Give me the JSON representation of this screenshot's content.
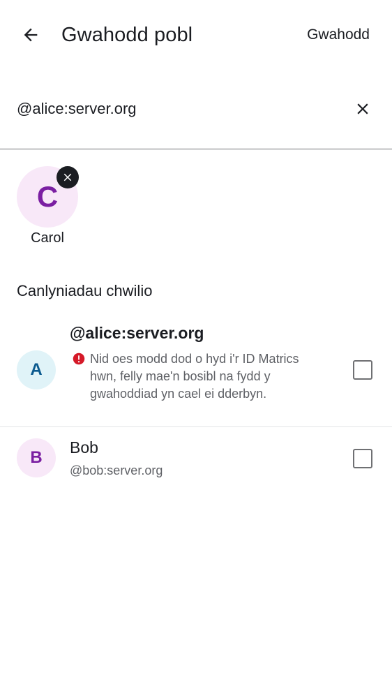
{
  "header": {
    "title": "Gwahodd pobl",
    "action_label": "Gwahodd",
    "back_icon": "arrow-left-icon"
  },
  "search": {
    "value": "@alice:server.org",
    "clear_icon": "close-icon"
  },
  "selected_users": [
    {
      "initial": "C",
      "name": "Carol",
      "remove_icon": "close-icon"
    }
  ],
  "results": {
    "section_title": "Canlyniadau chwilio",
    "items": [
      {
        "initial": "A",
        "name": "@alice:server.org",
        "warning": "Nid oes modd dod o hyd i'r ID Matrics hwn, felly mae'n bosibl na fydd y gwahoddiad yn cael ei dderbyn.",
        "warning_icon": "error-icon",
        "checked": false
      },
      {
        "initial": "B",
        "name": "Bob",
        "subtitle": "@bob:server.org",
        "checked": false
      }
    ]
  },
  "colors": {
    "text_primary": "#1b1d22",
    "text_secondary": "#5f6166",
    "error": "#d51928",
    "avatar_purple_bg": "#f8e8f8",
    "avatar_purple_fg": "#7b1fa2",
    "avatar_blue_bg": "#e0f3f8",
    "avatar_blue_fg": "#0b5a8f"
  }
}
